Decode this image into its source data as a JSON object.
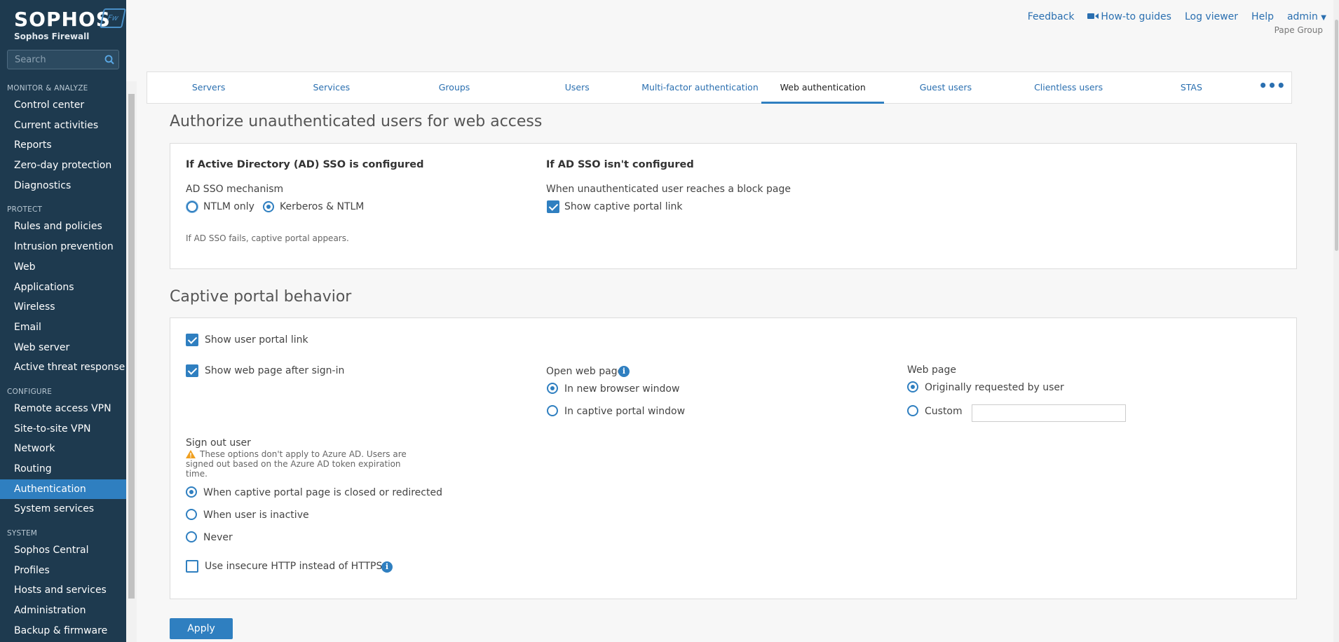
{
  "brand": {
    "logo": "SOPHOS",
    "badge": "Fw",
    "product": "Sophos Firewall"
  },
  "search": {
    "placeholder": "Search"
  },
  "sidebar": {
    "sections": [
      {
        "title": "MONITOR & ANALYZE",
        "items": [
          "Control center",
          "Current activities",
          "Reports",
          "Zero-day protection",
          "Diagnostics"
        ]
      },
      {
        "title": "PROTECT",
        "items": [
          "Rules and policies",
          "Intrusion prevention",
          "Web",
          "Applications",
          "Wireless",
          "Email",
          "Web server",
          "Active threat response"
        ]
      },
      {
        "title": "CONFIGURE",
        "items": [
          "Remote access VPN",
          "Site-to-site VPN",
          "Network",
          "Routing",
          "Authentication",
          "System services"
        ]
      },
      {
        "title": "SYSTEM",
        "items": [
          "Sophos Central",
          "Profiles",
          "Hosts and services",
          "Administration",
          "Backup & firmware"
        ]
      }
    ],
    "active_item": "Authentication"
  },
  "header": {
    "links": [
      "Feedback",
      "How-to guides",
      "Log viewer",
      "Help",
      "admin"
    ],
    "org": "Pape Group"
  },
  "tabs": [
    "Servers",
    "Services",
    "Groups",
    "Users",
    "Multi-factor authentication",
    "Web authentication",
    "Guest users",
    "Clientless users",
    "STAS"
  ],
  "active_tab": "Web authentication",
  "auth_section": {
    "title": "Authorize unauthenticated users for web access",
    "ad_configured": {
      "heading": "If Active Directory (AD) SSO is configured",
      "mechanism_label": "AD SSO mechanism",
      "options": [
        "NTLM only",
        "Kerberos & NTLM"
      ],
      "selected": "Kerberos & NTLM",
      "note": "If AD SSO fails, captive portal appears."
    },
    "ad_not_configured": {
      "heading": "If AD SSO isn't configured",
      "label": "When unauthenticated user reaches a block page",
      "checkbox": "Show captive portal link",
      "checked": true
    }
  },
  "captive_section": {
    "title": "Captive portal behavior",
    "show_user_portal_link": {
      "label": "Show user portal link",
      "checked": true
    },
    "show_web_page": {
      "label": "Show web page after sign-in",
      "checked": true
    },
    "open_web_page": {
      "label": "Open web page",
      "options": [
        "In new browser window",
        "In captive portal window"
      ],
      "selected": "In new browser window"
    },
    "web_page": {
      "label": "Web page",
      "options": [
        "Originally requested by user",
        "Custom"
      ],
      "selected": "Originally requested by user",
      "custom_value": ""
    },
    "sign_out": {
      "label": "Sign out user",
      "warning_line1": "These options don't apply to Azure AD. Users are",
      "warning_line2": "signed out based on the Azure AD token expiration",
      "warning_line3": "time.",
      "options": [
        "When captive portal page is closed or redirected",
        "When user is inactive",
        "Never"
      ],
      "selected": "When captive portal page is closed or redirected"
    },
    "insecure_http": {
      "label": "Use insecure HTTP instead of HTTPS",
      "checked": false
    }
  },
  "apply_label": "Apply",
  "colors": {
    "sidebar": "#1e3a4f",
    "accent": "#2f7fc0",
    "link": "#2a6fb0"
  }
}
